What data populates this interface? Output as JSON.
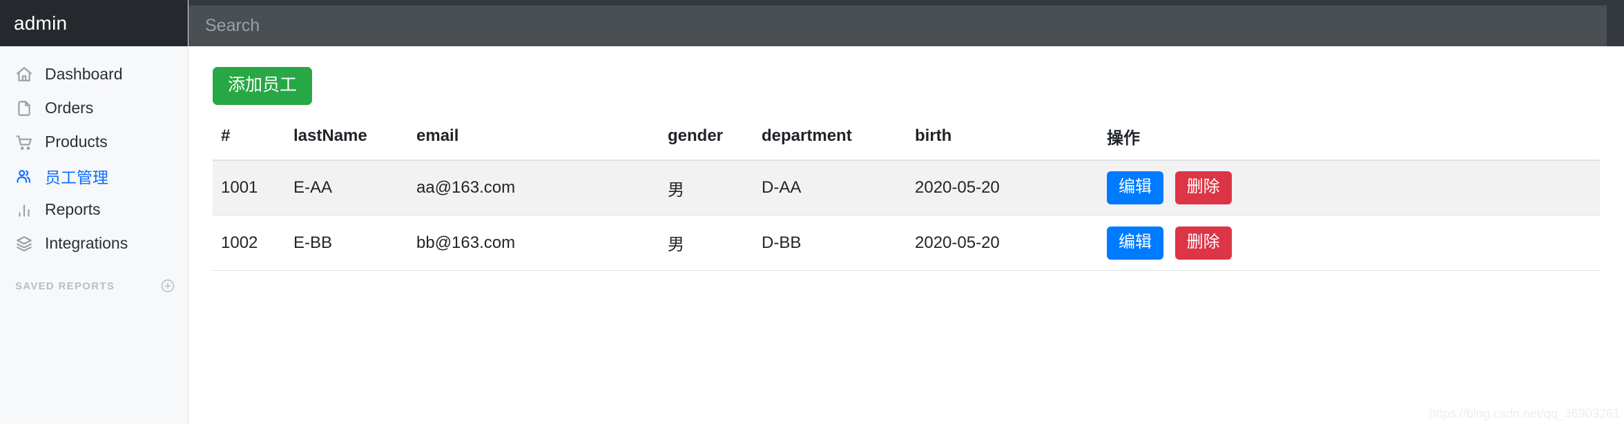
{
  "sidebar": {
    "brand": "admin",
    "items": [
      {
        "label": "Dashboard",
        "icon": "home-icon",
        "active": false
      },
      {
        "label": "Orders",
        "icon": "file-icon",
        "active": false
      },
      {
        "label": "Products",
        "icon": "shopping-cart-icon",
        "active": false
      },
      {
        "label": "员工管理",
        "icon": "users-icon",
        "active": true
      },
      {
        "label": "Reports",
        "icon": "bar-chart-icon",
        "active": false
      },
      {
        "label": "Integrations",
        "icon": "layers-icon",
        "active": false
      }
    ],
    "section_title": "SAVED REPORTS",
    "section_add_icon": "plus-circle-icon",
    "active_color": "#0d6efd"
  },
  "topbar": {
    "search_placeholder": "Search",
    "search_value": "",
    "background": "#343a40",
    "input_background": "#4a4f54"
  },
  "content": {
    "add_button_label": "添加员工",
    "add_button_color": "#28a745",
    "table": {
      "columns": [
        "#",
        "lastName",
        "email",
        "gender",
        "department",
        "birth",
        "操作"
      ],
      "rows": [
        {
          "id": "1001",
          "lastName": "E-AA",
          "email": "aa@163.com",
          "gender": "男",
          "department": "D-AA",
          "birth": "2020-05-20",
          "edit_label": "编辑",
          "delete_label": "删除"
        },
        {
          "id": "1002",
          "lastName": "E-BB",
          "email": "bb@163.com",
          "gender": "男",
          "department": "D-BB",
          "birth": "2020-05-20",
          "edit_label": "编辑",
          "delete_label": "删除"
        }
      ],
      "edit_color": "#007bff",
      "delete_color": "#dc3545"
    },
    "watermark": "https://blog.csdn.net/qq_36903261"
  }
}
